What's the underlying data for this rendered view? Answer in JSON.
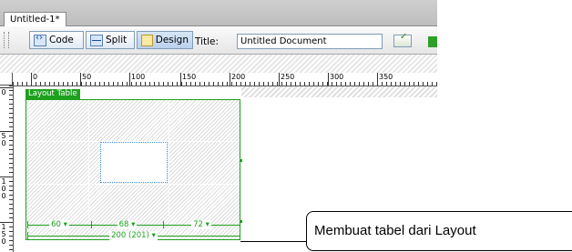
{
  "document_tab": {
    "label": "Untitled-1*"
  },
  "view_buttons": {
    "code": "Code",
    "split": "Split",
    "design": "Design"
  },
  "title_field": {
    "label": "Title:",
    "value": "Untitled Document"
  },
  "ruler": {
    "horizontal_marks": [
      "0",
      "50",
      "100",
      "150",
      "200",
      "250",
      "300",
      "350"
    ],
    "vertical_marks": [
      "0",
      "5 0",
      "1 0 0",
      "1 5 0"
    ]
  },
  "layout_table": {
    "tab_label": "Layout Table",
    "column_widths": [
      "60 ▾",
      "68 ▾",
      "72 ▾"
    ],
    "total_width": "200 (201) ▾",
    "accent_color": "#1ea01e"
  },
  "callout": {
    "text": "Membuat tabel dari Layout"
  },
  "icons": [
    "code-view-icon",
    "split-view-icon",
    "design-view-icon",
    "validate-markup-icon",
    "preview-icon"
  ]
}
